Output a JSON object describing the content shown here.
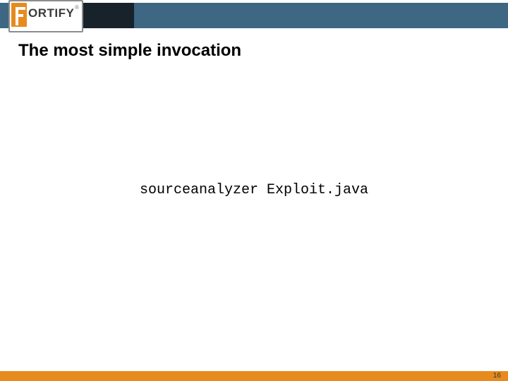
{
  "header": {
    "logo_text": "ORTIFY",
    "logo_reg": "®"
  },
  "slide": {
    "title": "The most simple invocation",
    "code": "sourceanalyzer Exploit.java"
  },
  "footer": {
    "page_number": "16"
  }
}
